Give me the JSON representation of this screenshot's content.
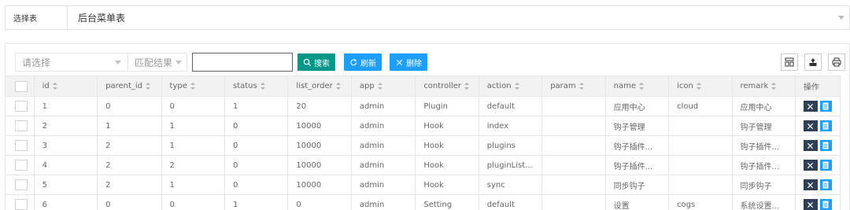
{
  "selector": {
    "label": "选择表",
    "value": "后台菜单表"
  },
  "toolbar": {
    "filter_placeholder": "请选择",
    "match_placeholder": "匹配结果",
    "search_value": "",
    "search_label": "搜索",
    "refresh_label": "刷新",
    "delete_label": "删除"
  },
  "columns": [
    "id",
    "parent_id",
    "type",
    "status",
    "list_order",
    "app",
    "controller",
    "action",
    "param",
    "name",
    "icon",
    "remark",
    "操作"
  ],
  "rows": [
    [
      "1",
      "0",
      "0",
      "1",
      "20",
      "admin",
      "Plugin",
      "default",
      "",
      "应用中心",
      "cloud",
      "应用中心"
    ],
    [
      "2",
      "1",
      "1",
      "0",
      "10000",
      "admin",
      "Hook",
      "index",
      "",
      "钩子管理",
      "",
      "钩子管理"
    ],
    [
      "3",
      "2",
      "1",
      "0",
      "10000",
      "admin",
      "Hook",
      "plugins",
      "",
      "钩子插件...",
      "",
      "钩子插件..."
    ],
    [
      "4",
      "2",
      "2",
      "0",
      "10000",
      "admin",
      "Hook",
      "pluginList...",
      "",
      "钩子插件...",
      "",
      "钩子插件..."
    ],
    [
      "5",
      "2",
      "1",
      "0",
      "10000",
      "admin",
      "Hook",
      "sync",
      "",
      "同步钩子",
      "",
      "同步钩子"
    ],
    [
      "6",
      "0",
      "0",
      "1",
      "0",
      "admin",
      "Setting",
      "default",
      "",
      "设置",
      "cogs",
      "系统设置..."
    ]
  ],
  "colors": {
    "search_btn": "#009688",
    "primary_btn": "#1e9fff",
    "delete_op": "#2f4056"
  }
}
